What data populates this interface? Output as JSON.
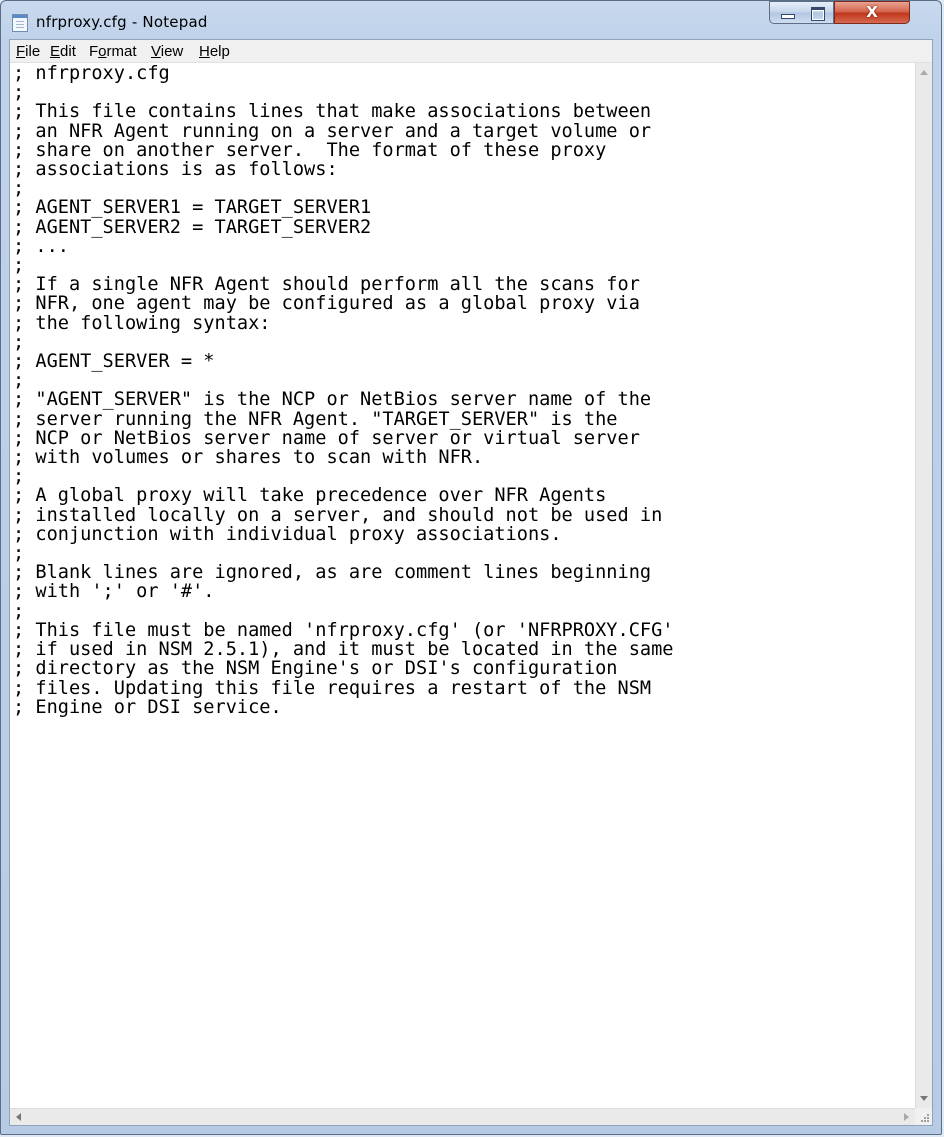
{
  "window": {
    "title": "nfrproxy.cfg - Notepad"
  },
  "icons": {
    "app": "notepad-icon",
    "minimize": "minimize-icon",
    "maximize": "maximize-icon",
    "close": "close-icon"
  },
  "close_glyph": "X",
  "menu": [
    {
      "id": "file",
      "label": "File",
      "accel": "F",
      "rest": "ile"
    },
    {
      "id": "edit",
      "label": "Edit",
      "accel": "E",
      "rest": "dit"
    },
    {
      "id": "format",
      "label": "Format",
      "accel": "o",
      "pre": "F",
      "rest": "rmat"
    },
    {
      "id": "view",
      "label": "View",
      "accel": "V",
      "rest": "iew"
    },
    {
      "id": "help",
      "label": "Help",
      "accel": "H",
      "rest": "elp"
    }
  ],
  "document": {
    "lines": [
      "; nfrproxy.cfg",
      ";",
      "; This file contains lines that make associations between",
      "; an NFR Agent running on a server and a target volume or",
      "; share on another server.  The format of these proxy",
      "; associations is as follows:",
      ";",
      "; AGENT_SERVER1 = TARGET_SERVER1",
      "; AGENT_SERVER2 = TARGET_SERVER2",
      "; ...",
      ";",
      "; If a single NFR Agent should perform all the scans for",
      "; NFR, one agent may be configured as a global proxy via",
      "; the following syntax:",
      ";",
      "; AGENT_SERVER = *",
      ";",
      "; \"AGENT_SERVER\" is the NCP or NetBios server name of the",
      "; server running the NFR Agent. \"TARGET_SERVER\" is the",
      "; NCP or NetBios server name of server or virtual server",
      "; with volumes or shares to scan with NFR.",
      ";",
      "; A global proxy will take precedence over NFR Agents",
      "; installed locally on a server, and should not be used in",
      "; conjunction with individual proxy associations.",
      ";",
      "; Blank lines are ignored, as are comment lines beginning",
      "; with ';' or '#'.",
      ";",
      "; This file must be named 'nfrproxy.cfg' (or 'NFRPROXY.CFG'",
      "; if used in NSM 2.5.1), and it must be located in the same",
      "; directory as the NSM Engine's or DSI's configuration",
      "; files. Updating this file requires a restart of the NSM",
      "; Engine or DSI service."
    ]
  }
}
